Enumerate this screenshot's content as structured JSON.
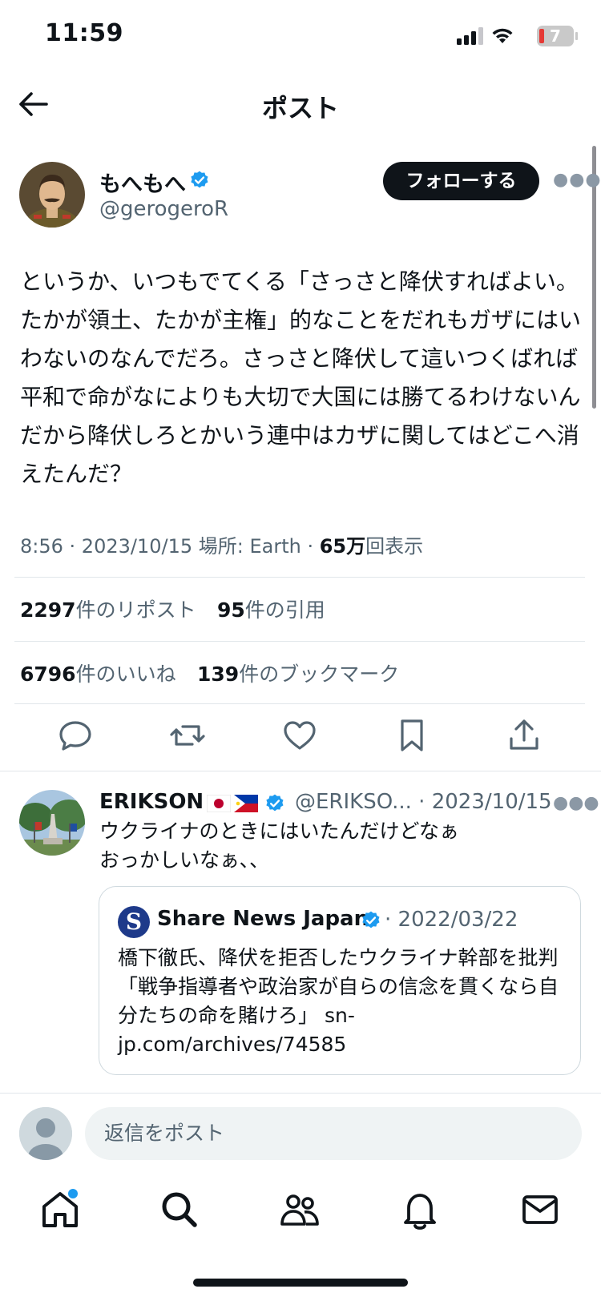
{
  "status_bar": {
    "time": "11:59",
    "battery": "7"
  },
  "nav": {
    "title": "ポスト"
  },
  "author": {
    "name": "もへもへ",
    "handle": "@gerogeroR",
    "follow_label": "フォローする"
  },
  "tweet": {
    "text": "というか、いつもでてくる「さっさと降伏すればよい。たかが領土、たかが主権」的なことをだれもガザにはいわないのなんでだろ。さっさと降伏して這いつくばれば平和で命がなによりも大切で大国には勝てるわけないんだから降伏しろとかいう連中はカザに関してはどこへ消えたんだ？",
    "time": "8:56",
    "date": "2023/10/15",
    "location": "場所: Earth",
    "views_number": "65",
    "views_unit": "万",
    "views_label": "回表示"
  },
  "stats": {
    "reposts_count": "2297",
    "reposts_label": "件のリポスト",
    "quotes_count": "95",
    "quotes_label": "件の引用",
    "likes_count": "6796",
    "likes_label": "件のいいね",
    "bookmarks_count": "139",
    "bookmarks_label": "件のブックマーク"
  },
  "actions": [
    "reply-icon",
    "repost-icon",
    "like-icon",
    "bookmark-icon",
    "share-icon"
  ],
  "reply": {
    "name": "ERIKSON",
    "handle": "@ERIKSO...",
    "date": "2023/10/15",
    "text_line1": "ウクライナのときにはいたんだけどなぁ",
    "text_line2": "おっかしいなぁ、、",
    "quote": {
      "logo": "S",
      "source": "Share News Japan",
      "date": "2022/03/22",
      "text": "橋下徹氏、降伏を拒否したウクライナ幹部を批判「戦争指導者や政治家が自らの信念を貫くなら自分たちの命を賭けろ」 sn-jp.com/archives/74585"
    }
  },
  "composer": {
    "placeholder": "返信をポスト"
  },
  "tab_bar": [
    "home-icon",
    "search-icon",
    "communities-icon",
    "notifications-icon",
    "messages-icon"
  ],
  "colors": {
    "accent": "#1d9bf0",
    "text": "#0f1419",
    "secondary": "#536471",
    "divider": "#e1e6ea"
  }
}
